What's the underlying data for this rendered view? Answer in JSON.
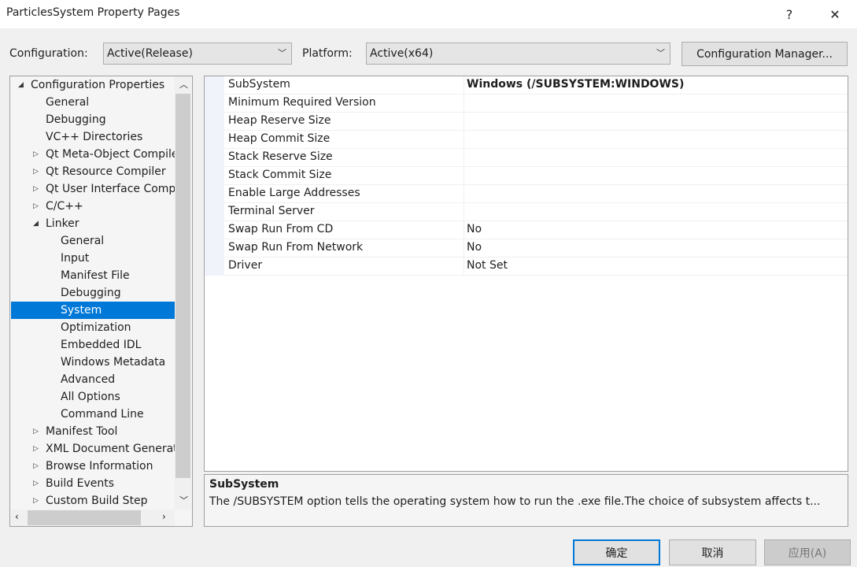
{
  "window": {
    "title": "ParticlesSystem Property Pages",
    "help": "?",
    "close": "✕"
  },
  "config": {
    "configuration_label": "Configuration:",
    "configuration_value": "Active(Release)",
    "platform_label": "Platform:",
    "platform_value": "Active(x64)",
    "manager_button": "Configuration Manager..."
  },
  "tree": {
    "items": [
      {
        "label": "Configuration Properties",
        "level": 0,
        "expander": "expanded"
      },
      {
        "label": "General",
        "level": 1
      },
      {
        "label": "Debugging",
        "level": 1
      },
      {
        "label": "VC++ Directories",
        "level": 1
      },
      {
        "label": "Qt Meta-Object Compiler",
        "level": 1,
        "expander": "collapsed"
      },
      {
        "label": "Qt Resource Compiler",
        "level": 1,
        "expander": "collapsed"
      },
      {
        "label": "Qt User Interface Compiler",
        "level": 1,
        "expander": "collapsed"
      },
      {
        "label": "C/C++",
        "level": 1,
        "expander": "collapsed"
      },
      {
        "label": "Linker",
        "level": 1,
        "expander": "expanded"
      },
      {
        "label": "General",
        "level": 2
      },
      {
        "label": "Input",
        "level": 2
      },
      {
        "label": "Manifest File",
        "level": 2
      },
      {
        "label": "Debugging",
        "level": 2
      },
      {
        "label": "System",
        "level": 2,
        "selected": true
      },
      {
        "label": "Optimization",
        "level": 2
      },
      {
        "label": "Embedded IDL",
        "level": 2
      },
      {
        "label": "Windows Metadata",
        "level": 2
      },
      {
        "label": "Advanced",
        "level": 2
      },
      {
        "label": "All Options",
        "level": 2
      },
      {
        "label": "Command Line",
        "level": 2
      },
      {
        "label": "Manifest Tool",
        "level": 1,
        "expander": "collapsed"
      },
      {
        "label": "XML Document Generator",
        "level": 1,
        "expander": "collapsed"
      },
      {
        "label": "Browse Information",
        "level": 1,
        "expander": "collapsed"
      },
      {
        "label": "Build Events",
        "level": 1,
        "expander": "collapsed"
      },
      {
        "label": "Custom Build Step",
        "level": 1,
        "expander": "collapsed"
      }
    ]
  },
  "properties": [
    {
      "name": "SubSystem",
      "value": "Windows (/SUBSYSTEM:WINDOWS)",
      "bold": true
    },
    {
      "name": "Minimum Required Version",
      "value": ""
    },
    {
      "name": "Heap Reserve Size",
      "value": ""
    },
    {
      "name": "Heap Commit Size",
      "value": ""
    },
    {
      "name": "Stack Reserve Size",
      "value": ""
    },
    {
      "name": "Stack Commit Size",
      "value": ""
    },
    {
      "name": "Enable Large Addresses",
      "value": ""
    },
    {
      "name": "Terminal Server",
      "value": ""
    },
    {
      "name": "Swap Run From CD",
      "value": "No"
    },
    {
      "name": "Swap Run From Network",
      "value": "No"
    },
    {
      "name": "Driver",
      "value": "Not Set"
    }
  ],
  "description": {
    "title": "SubSystem",
    "text": "The /SUBSYSTEM option tells the operating system how to run the .exe file.The choice of subsystem affects t..."
  },
  "buttons": {
    "ok": "确定",
    "cancel": "取消",
    "apply": "应用(A)"
  },
  "colors": {
    "selection": "#0078d7"
  }
}
